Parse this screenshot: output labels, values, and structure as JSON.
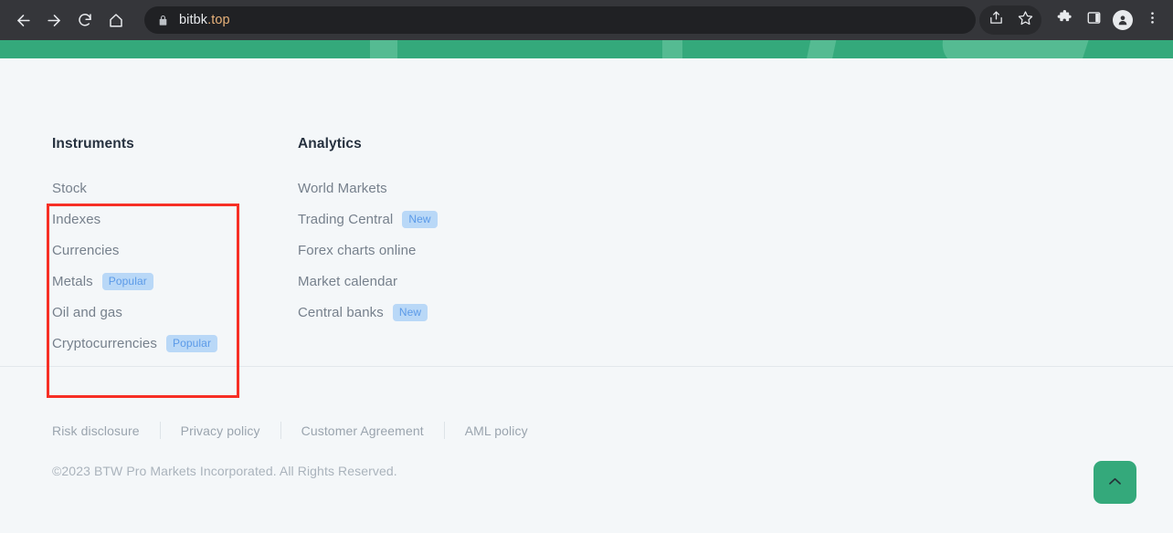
{
  "browser": {
    "back_icon": "arrow-left-icon",
    "forward_icon": "arrow-right-icon",
    "reload_icon": "reload-icon",
    "home_icon": "home-icon",
    "lock_icon": "lock-icon",
    "url": "bitbk.top",
    "url_domain": "bitbk",
    "url_tld": ".top",
    "share_icon": "share-icon",
    "bookmark_icon": "star-icon",
    "extensions_icon": "puzzle-piece-icon",
    "side_panel_icon": "side-panel-icon",
    "profile_icon": "profile-avatar-icon",
    "menu_icon": "three-dot-menu-icon"
  },
  "theme": {
    "page_bg": "#f4f7f9",
    "brand_green": "#34a97b",
    "brand_green_light": "#55bb92",
    "badge_bg": "#b9d8f7",
    "badge_text": "#5b9ae8",
    "heading_text": "#26313f",
    "link_text": "#76808c",
    "footer_text": "#9aa4ae",
    "annotation_red": "#f72f25",
    "toolbar_bg": "#35363a",
    "omnibox_bg": "#202124"
  },
  "columns": [
    {
      "title": "Instruments",
      "highlighted": true,
      "items": [
        {
          "label": "Stock",
          "badge": null
        },
        {
          "label": "Indexes",
          "badge": null
        },
        {
          "label": "Currencies",
          "badge": null
        },
        {
          "label": "Metals",
          "badge": "Popular"
        },
        {
          "label": "Oil and gas",
          "badge": null
        },
        {
          "label": "Cryptocurrencies",
          "badge": "Popular"
        }
      ]
    },
    {
      "title": "Analytics",
      "highlighted": false,
      "items": [
        {
          "label": "World Markets",
          "badge": null
        },
        {
          "label": "Trading Central",
          "badge": "New"
        },
        {
          "label": "Forex charts online",
          "badge": null
        },
        {
          "label": "Market calendar",
          "badge": null
        },
        {
          "label": "Central banks",
          "badge": "New"
        }
      ]
    }
  ],
  "footer": {
    "links": [
      "Risk disclosure",
      "Privacy policy",
      "Customer Agreement",
      "AML policy"
    ],
    "copyright": "©2023 BTW Pro Markets Incorporated. All Rights Reserved."
  },
  "scroll_top_button": {
    "icon": "chevron-up-icon",
    "label": ""
  }
}
